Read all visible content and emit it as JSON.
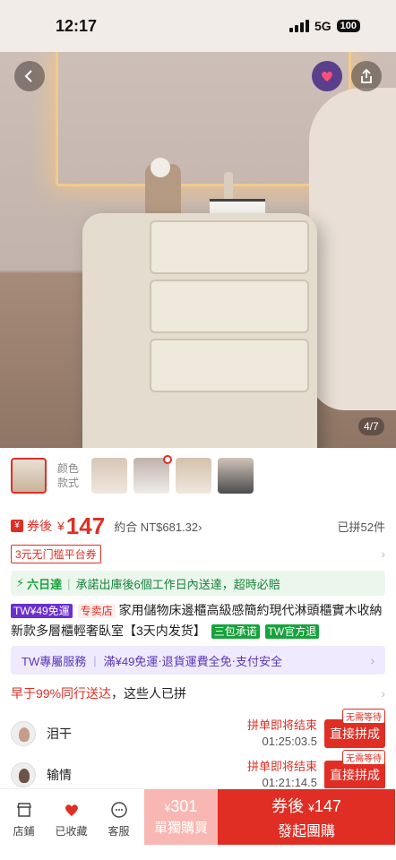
{
  "status_bar": {
    "time": "12:17",
    "network": "5G",
    "battery": "100"
  },
  "gallery": {
    "counter": "4/7"
  },
  "variants": {
    "label_line1": "颜色",
    "label_line2": "款式"
  },
  "price": {
    "label": "券後",
    "currency": "¥",
    "value": "147",
    "ntd": "約合 NT$681.32",
    "ntd_chevron": "›",
    "sold": "已拼52件"
  },
  "coupon": {
    "label": "3元无门槛平台券",
    "chevron": "›"
  },
  "shipping": {
    "fast": "六日達",
    "note": "承諾出庫後6個工作日內送達，超時必賠"
  },
  "title": {
    "tag_free_ship": "TW¥49免運",
    "tag_store": "专卖店",
    "text": "家用儲物床邊櫃高級感簡約現代淋頭櫃實木收納新款多層櫃輕奢臥室【3天内发货】",
    "tag_guarantee": "三包承诺",
    "tag_tw_return": "TW官方退"
  },
  "tw_service": {
    "label": "TW專屬服務",
    "item1": "滿¥49免運",
    "item2": "退貨運費全免",
    "item3": "支付安全",
    "chevron": "›"
  },
  "ranking": {
    "highlight": "早于99%同行送达",
    "text": "，这些人已拼",
    "chevron": "›"
  },
  "groups": [
    {
      "name": "泪干",
      "status": "拼单即将结束",
      "timer": "01:25:03.5",
      "badge": "无需等待",
      "action": "直接拼成"
    },
    {
      "name": "输情",
      "status": "拼单即将结束",
      "timer": "01:21:14.5",
      "badge": "无需等待",
      "action": "直接拼成"
    }
  ],
  "bottom_bar": {
    "store": "店鋪",
    "favorited": "已收藏",
    "service": "客服",
    "single_currency": "¥",
    "single_price": "301",
    "single_label": "單獨購買",
    "group_prefix": "券後",
    "group_currency": "¥",
    "group_price": "147",
    "group_label": "發起團購"
  },
  "colors": {
    "accent": "#e02e24",
    "green": "#17a23b",
    "purple": "#6a2fd0"
  }
}
